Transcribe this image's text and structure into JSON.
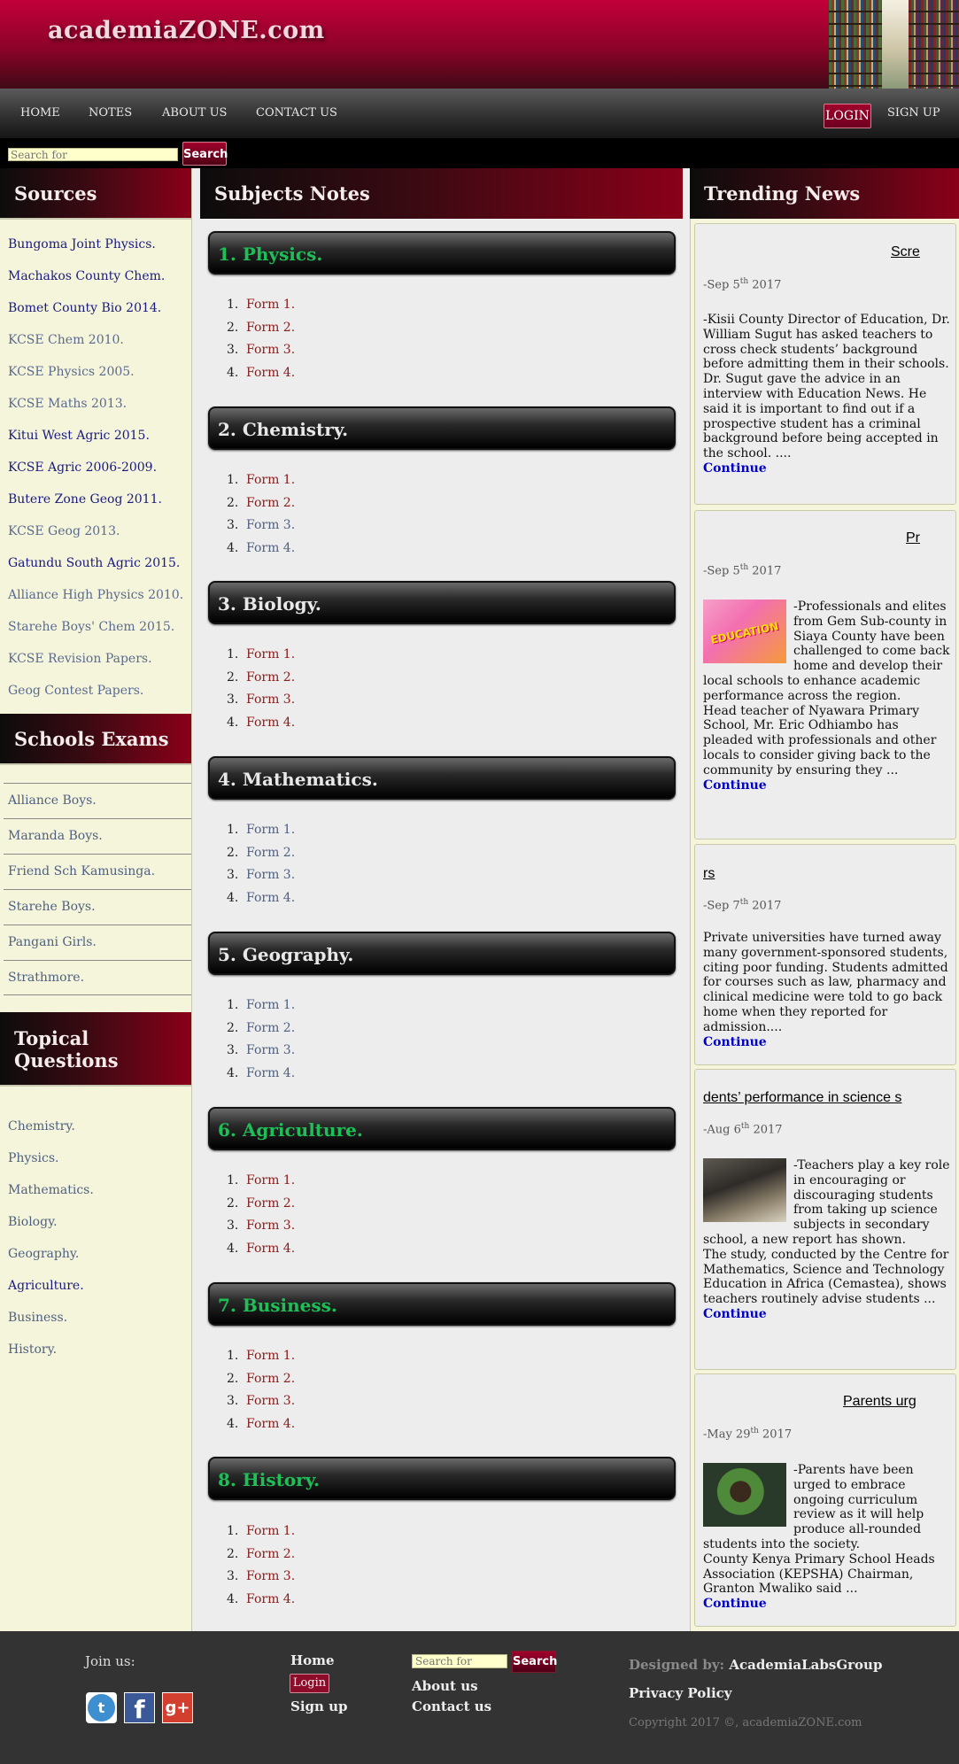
{
  "header": {
    "site_title": "academiaZONE.com"
  },
  "nav": {
    "items": [
      "HOME",
      "NOTES",
      "ABOUT US",
      "CONTACT US"
    ],
    "login": "LOGIN",
    "signup": "SIGN UP"
  },
  "search": {
    "placeholder": "Search for",
    "button": "Search"
  },
  "sources": {
    "heading": "Sources",
    "links": [
      "Bungoma Joint Physics.",
      "Machakos County Chem.",
      "Bomet County Bio 2014.",
      "KCSE Chem 2010.",
      "KCSE Physics 2005.",
      "KCSE Maths 2013.",
      "Kitui West Agric 2015.",
      "KCSE Agric 2006-2009.",
      "Butere Zone Geog 2011.",
      "KCSE Geog 2013.",
      "Gatundu South Agric 2015.",
      "Alliance High Physics 2010.",
      "Starehe Boys' Chem 2015.",
      "KCSE Revision Papers.",
      "Geog Contest Papers."
    ]
  },
  "school_exams": {
    "heading": "Schools Exams",
    "links": [
      "Alliance Boys.",
      "Maranda Boys.",
      "Friend Sch Kamusinga.",
      "Starehe Boys.",
      "Pangani Girls.",
      "Strathmore."
    ]
  },
  "topical": {
    "heading_line1": "Topical",
    "heading_line2": "Questions",
    "links": [
      "Chemistry.",
      "Physics.",
      "Mathematics.",
      "Biology.",
      "Geography.",
      "Agriculture.",
      "Business.",
      "History."
    ]
  },
  "subjects": {
    "heading": "Subjects Notes",
    "forms": [
      "Form 1.",
      "Form 2.",
      "Form 3.",
      "Form 4."
    ],
    "list": [
      {
        "title": "1. Physics."
      },
      {
        "title": "2. Chemistry."
      },
      {
        "title": "3. Biology."
      },
      {
        "title": "4. Mathematics."
      },
      {
        "title": "5. Geography."
      },
      {
        "title": "6. Agriculture."
      },
      {
        "title": "7. Business."
      },
      {
        "title": "8. History."
      }
    ]
  },
  "news": {
    "heading": "Trending News",
    "continue": "Continue",
    "items": [
      {
        "title": "Scre",
        "date_pre": "-Sep 5",
        "date_sup": "th",
        "date_post": " 2017",
        "text": "-Kisii County Director of Education, Dr. William Sugut has asked teachers to cross check students’ background before admitting them in their schools.\nDr. Sugut gave the advice in an interview with Education News. He said it is important to find out if a prospective student has a criminal background before being accepted in the school. ....",
        "image": ""
      },
      {
        "title": "Pr",
        "date_pre": "-Sep 5",
        "date_sup": "th",
        "date_post": " 2017",
        "text": "-Professionals and elites from Gem Sub-county in Siaya County have been challenged to come back home and develop their local schools to enhance academic performance across the region.\nHead teacher of Nyawara Primary School, Mr. Eric Odhiambo has pleaded with professionals and other locals to consider giving back to the community by ensuring they ...",
        "image": "education-magazine-image"
      },
      {
        "title": "rs",
        "date_pre": "-Sep 7",
        "date_sup": "th",
        "date_post": " 2017",
        "text": "Private universities have turned away many government-sponsored students, citing poor funding. Students admitted for courses such as law, pharmacy and clinical medicine were told to go back home when they reported for admission....",
        "image": ""
      },
      {
        "title": "dents’ performance in science s",
        "date_pre": "-Aug 6",
        "date_sup": "th",
        "date_post": " 2017",
        "text": "-Teachers play a key role in encouraging or discouraging students from taking up science subjects in secondary school, a new report has shown.\nThe study, conducted by the Centre for Mathematics, Science and Technology Education in Africa (Cemastea), shows teachers routinely advise students ...",
        "image": "science-lab-photo"
      },
      {
        "title": "Parents urg",
        "date_pre": "-May 29",
        "date_sup": "th",
        "date_post": " 2017",
        "text": "-Parents have been urged to embrace ongoing curriculum review as it will help produce all-rounded students into the society.\nCounty Kenya Primary School Heads Association (KEPSHA) Chairman, Granton Mwaliko said ...",
        "image": "chairman-portrait-photo"
      }
    ]
  },
  "footer": {
    "join": "Join us:",
    "home": "Home",
    "login": "Login",
    "signup": "Sign up",
    "about": "About us",
    "contact": "Contact us",
    "search_placeholder": "Search for",
    "search_button": "Search",
    "designed_by_label": "Designed by:",
    "designed_by_name": "AcademiaLabsGroup",
    "privacy": "Privacy Policy",
    "copyright": "Copyright 2017 ©, academiaZONE.com",
    "social": [
      {
        "name": "twitter-icon",
        "glyph": "t"
      },
      {
        "name": "facebook-icon",
        "glyph": "f"
      },
      {
        "name": "google-plus-icon",
        "glyph": "g+"
      }
    ]
  }
}
